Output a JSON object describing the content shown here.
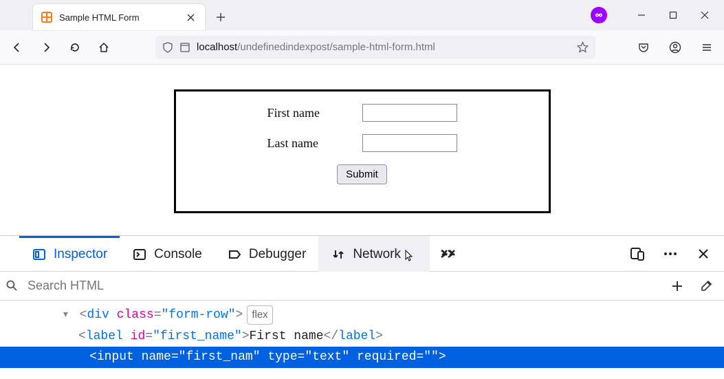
{
  "window": {
    "tab_title": "Sample HTML Form",
    "favicon_letters": "⊠"
  },
  "url": {
    "domain": "localhost",
    "path": "/undefinedindexpost/sample-html-form.html"
  },
  "form": {
    "first_name_label": "First name",
    "last_name_label": "Last name",
    "first_name_value": "",
    "last_name_value": "",
    "submit_label": "Submit"
  },
  "devtools": {
    "tabs": {
      "inspector": "Inspector",
      "console": "Console",
      "debugger": "Debugger",
      "network": "Network"
    },
    "search_placeholder": "Search HTML",
    "html": {
      "row1_open": "<div ",
      "row1_attr": "class",
      "row1_val": "\"form-row\"",
      "row1_close": ">",
      "row1_badge": "flex",
      "row2": "<label id=\"first_name\">First name</label>",
      "row3": "<input name=\"first_nam\" type=\"text\" required=\"\">",
      "row2_tag": "label",
      "row2_attr1": "id",
      "row2_val1": "\"first_name\"",
      "row2_text": "First name",
      "row3_tag": "input",
      "row3_attr1": "name",
      "row3_val1": "\"first_nam\"",
      "row3_attr2": "type",
      "row3_val2": "\"text\"",
      "row3_attr3": "required",
      "row3_val3": "\"\""
    }
  }
}
